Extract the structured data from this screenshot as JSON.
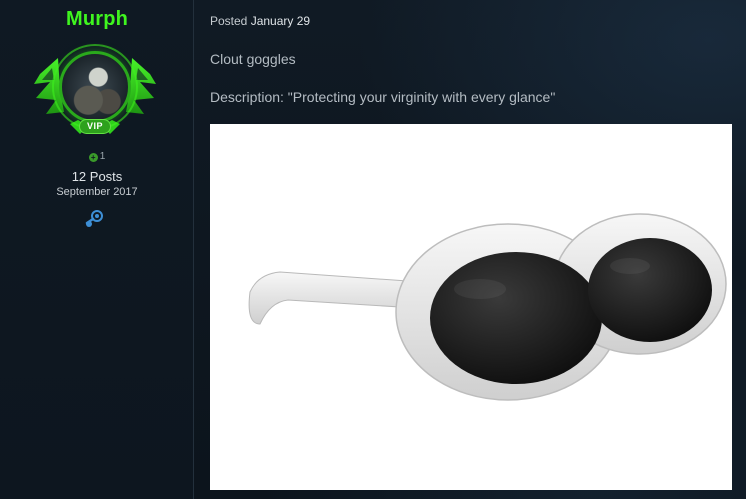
{
  "author": {
    "username": "Murph",
    "badge": "VIP",
    "reputation": "1",
    "posts": "12 Posts",
    "joined": "September 2017",
    "profile_link_icon": "steam-icon",
    "colors": {
      "username": "#3ff51f",
      "badge": "#2ea11d"
    }
  },
  "post": {
    "posted_label": "Posted",
    "posted_date": "January 29",
    "line1": "Clout goggles",
    "line2": "Description: \"Protecting your virginity with every glance\""
  }
}
